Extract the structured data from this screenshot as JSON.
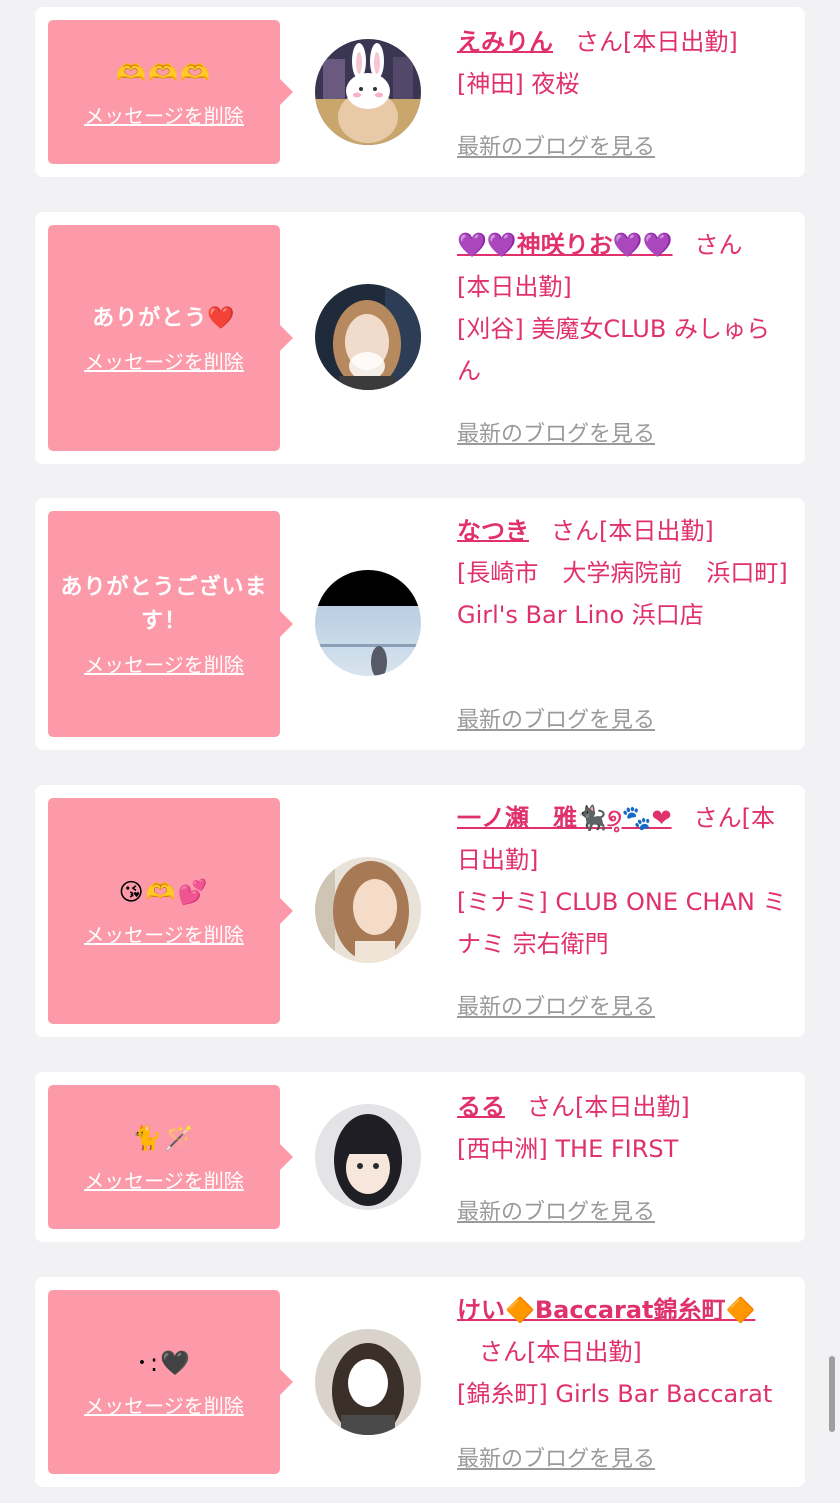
{
  "cards": [
    {
      "message": "🫶🫶🫶",
      "delete_label": "メッセージを削除",
      "name": "えみりん",
      "honorific": "さん",
      "status": "[本日出勤]",
      "area": "[神田]",
      "shop": "夜桜",
      "blog_label": "最新のブログを見る",
      "avatar_icon": "rabbit-sticker-avatar"
    },
    {
      "message": "ありがとう❤️",
      "delete_label": "メッセージを削除",
      "name": "💜💜神咲りお💜💜",
      "honorific": "さん",
      "status": "[本日出勤]",
      "area": "[刈谷]",
      "shop": "美魔女CLUB みしゅらん",
      "blog_label": "最新のブログを見る",
      "avatar_icon": "profile-photo-avatar"
    },
    {
      "message": "ありがとうございます！",
      "delete_label": "メッセージを削除",
      "name": "なつき",
      "honorific": "さん",
      "status": "[本日出勤]",
      "area": "[長崎市　大学病院前　浜口町]",
      "shop": "Girl's Bar Lino 浜口店",
      "blog_label": "最新のブログを見る",
      "avatar_icon": "sky-photo-avatar"
    },
    {
      "message": "😘🫶💕",
      "delete_label": "メッセージを削除",
      "name": "一ノ瀬　雅🐈‍⬛୭̥🐾❤",
      "honorific": "さん",
      "status": "[本日出勤]",
      "area": "[ミナミ]",
      "shop": "CLUB ONE CHAN ミナミ 宗右衛門",
      "blog_label": "最新のブログを見る",
      "avatar_icon": "profile-photo-avatar"
    },
    {
      "message": "🐈🪄",
      "delete_label": "メッセージを削除",
      "name": "るる",
      "honorific": "さん",
      "status": "[本日出勤]",
      "area": "[西中洲]",
      "shop": "THE FIRST",
      "blog_label": "最新のブログを見る",
      "avatar_icon": "profile-photo-avatar"
    },
    {
      "message": "･:🖤",
      "delete_label": "メッセージを削除",
      "name": "けい🔶Baccarat錦糸町🔶",
      "honorific": "さん",
      "status": "[本日出勤]",
      "area": "[錦糸町]",
      "shop": "Girls Bar Baccarat",
      "blog_label": "最新のブログを見る",
      "avatar_icon": "profile-photo-avatar"
    }
  ],
  "colors": {
    "bubble": "#fd9aa9",
    "name": "#e0306d",
    "link_gray": "#9a9a9a",
    "background": "#f2f2f4"
  }
}
